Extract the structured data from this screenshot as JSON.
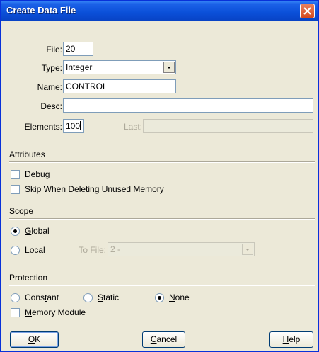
{
  "window": {
    "title": "Create Data File"
  },
  "form": {
    "file_label": "File:",
    "file_value": "20",
    "type_label": "Type:",
    "type_value": "Integer",
    "name_label": "Name:",
    "name_value": "CONTROL",
    "desc_label": "Desc:",
    "desc_value": "",
    "elements_label": "Elements:",
    "elements_value": "100",
    "last_label": "Last:",
    "last_value": ""
  },
  "attributes": {
    "title": "Attributes",
    "debug": {
      "pre": "",
      "u": "D",
      "post": "ebug",
      "checked": false
    },
    "skip": {
      "pre": "Skip When Deleting Unused Memory",
      "u": "",
      "post": "",
      "checked": false
    }
  },
  "scope": {
    "title": "Scope",
    "global": {
      "pre": "",
      "u": "G",
      "post": "lobal",
      "selected": true
    },
    "local": {
      "pre": "",
      "u": "L",
      "post": "ocal",
      "selected": false
    },
    "to_file_label": "To File:",
    "to_file_value": "2 -"
  },
  "protection": {
    "title": "Protection",
    "constant": {
      "pre": "Cons",
      "u": "t",
      "post": "ant",
      "selected": false
    },
    "static": {
      "pre": "",
      "u": "S",
      "post": "tatic",
      "selected": false
    },
    "none": {
      "pre": "",
      "u": "N",
      "post": "one",
      "selected": true
    },
    "memory_module": {
      "pre": "",
      "u": "M",
      "post": "emory Module",
      "checked": false
    }
  },
  "buttons": {
    "ok": {
      "pre": "",
      "u": "O",
      "post": "K"
    },
    "cancel": {
      "pre": "",
      "u": "C",
      "post": "ancel"
    },
    "help": {
      "pre": "",
      "u": "H",
      "post": "elp"
    }
  }
}
